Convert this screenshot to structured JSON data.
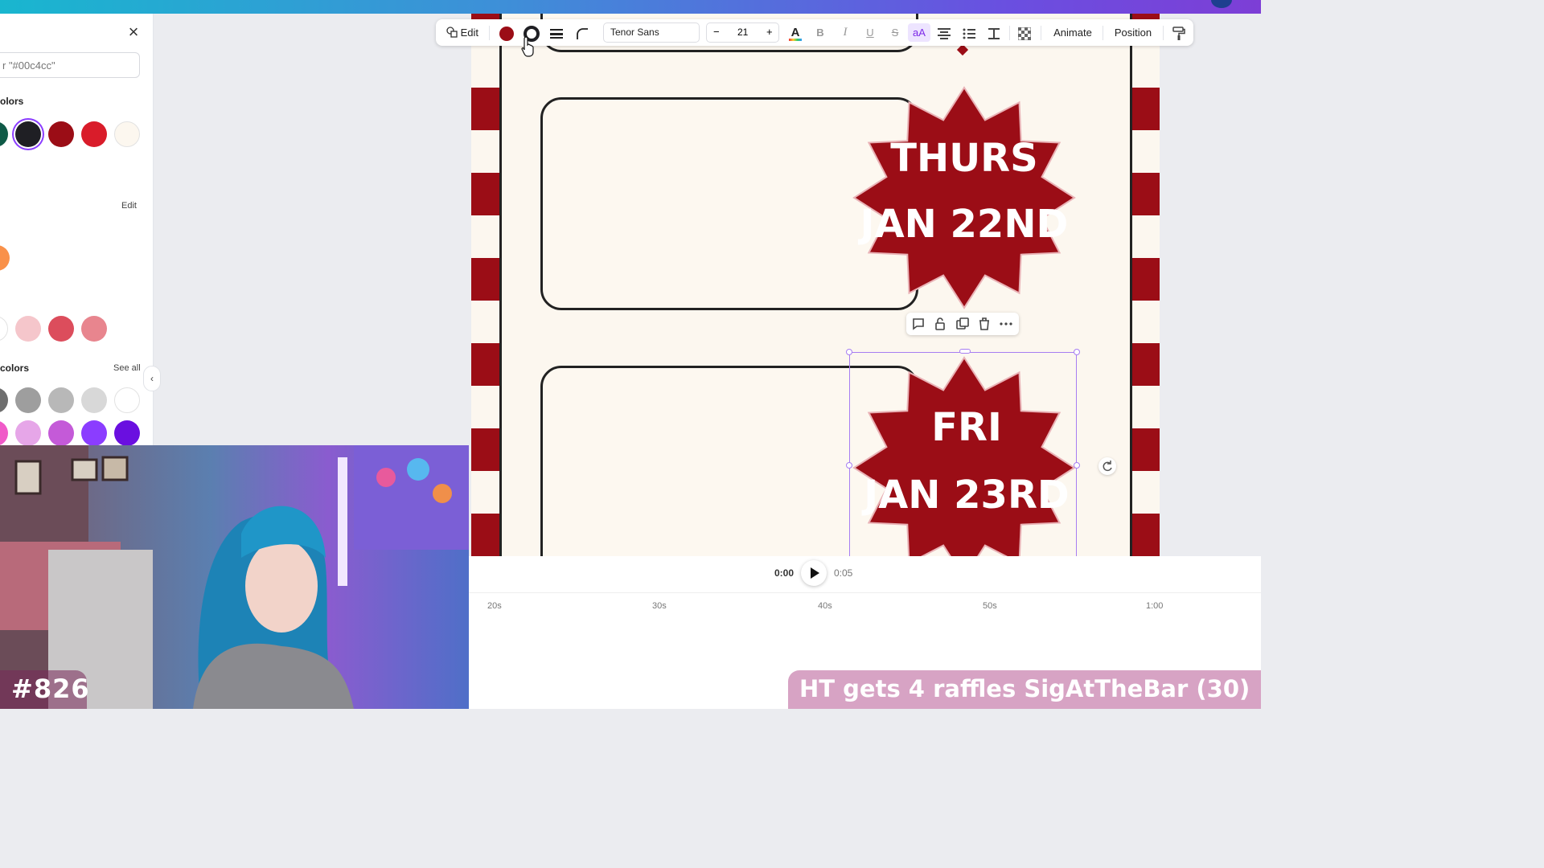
{
  "colors": {
    "accent": "#8b3dff",
    "brand_red": "#9b0d16",
    "cream": "#fcf7ef"
  },
  "color_panel": {
    "search_placeholder": "r \"#00c4cc\"",
    "doc_colors_title": "olors",
    "edit_link": "Edit",
    "default_colors_title": "colors",
    "see_all_link": "See all",
    "document_swatches": [
      "#0f5a47",
      "#1f1f24",
      "#9b0d16",
      "#d91c2a",
      "#fcf7ef"
    ],
    "photo_swatch": "#f9914a",
    "palette_swatches": [
      "#ffffff",
      "#f5c6cb",
      "#dc4d5c",
      "#e8858e"
    ],
    "default_row1": [
      "#6e6e6e",
      "#9e9e9e",
      "#b8b8b8",
      "#d8d8d8",
      "#ffffff"
    ],
    "default_row2": [
      "#f05ac8",
      "#e6a6e8",
      "#c45ad8",
      "#8b3dff",
      "#6a0fe0"
    ]
  },
  "toolbar": {
    "edit_label": "Edit",
    "font_name": "Tenor Sans",
    "font_size": "21",
    "minus_label": "−",
    "plus_label": "+",
    "bold_label": "B",
    "italic_label": "I",
    "underline_label": "U",
    "strike_label": "S",
    "case_label": "aA",
    "animate_label": "Animate",
    "position_label": "Position",
    "fill_color": "#9b0d16"
  },
  "design": {
    "badge1": {
      "line1": "THURS",
      "line2": "JAN 22ND"
    },
    "badge2": {
      "line1": "FRI",
      "line2": "JAN 23RD"
    }
  },
  "timeline": {
    "current_time": "0:00",
    "duration": "0:05",
    "ticks": [
      "20s",
      "30s",
      "40s",
      "50s",
      "1:00"
    ]
  },
  "overlay": {
    "counter": "#826",
    "raffle_text": "HT gets 4 raffles SigAtTheBar (30)"
  }
}
